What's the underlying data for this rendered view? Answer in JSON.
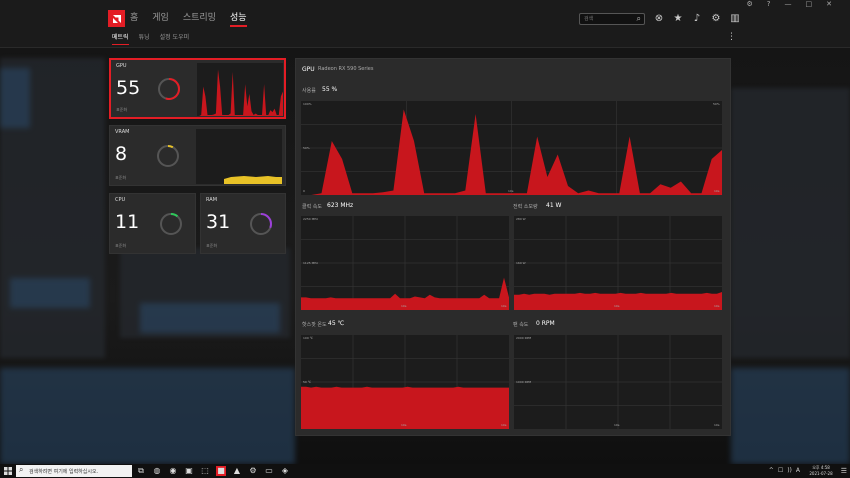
{
  "window": {
    "controls": [
      "⚙",
      "?",
      "—",
      "□",
      "✕"
    ]
  },
  "nav": {
    "tabs": [
      {
        "label": "홈",
        "active": false
      },
      {
        "label": "게임",
        "active": false
      },
      {
        "label": "스트리밍",
        "active": false
      },
      {
        "label": "성능",
        "active": true
      }
    ],
    "search_placeholder": "검색"
  },
  "subnav": {
    "tabs": [
      {
        "label": "메트릭",
        "active": true
      },
      {
        "label": "튜닝",
        "active": false
      },
      {
        "label": "설정 도우미",
        "active": false
      }
    ]
  },
  "tiles": {
    "gpu": {
      "label": "GPU",
      "value": "55",
      "sub": "표준화",
      "percent": 55,
      "color": "#e31d25"
    },
    "vram": {
      "label": "VRAM",
      "value": "8",
      "sub": "표준화",
      "percent": 8,
      "color": "#e8c227"
    },
    "cpu": {
      "label": "CPU",
      "value": "11",
      "sub": "표준화",
      "percent": 11,
      "color": "#2ec85a"
    },
    "ram": {
      "label": "RAM",
      "value": "31",
      "sub": "표준화",
      "percent": 31,
      "color": "#9c3fd9"
    }
  },
  "panel": {
    "title": "GPU",
    "device": "Radeon RX 590 Series",
    "usage": {
      "label": "사용률",
      "value": "55 %",
      "y_top": "100%",
      "y_mid": "50%",
      "y_zero": "0",
      "x_mid": "10s",
      "x_end": "10s",
      "y_top_right": "50%",
      "y_mid_right": "50%",
      "series": [
        0,
        0,
        2,
        60,
        40,
        2,
        2,
        2,
        3,
        5,
        95,
        60,
        2,
        2,
        2,
        2,
        5,
        90,
        2,
        2,
        2,
        2,
        2,
        65,
        20,
        45,
        10,
        2,
        5,
        2,
        2,
        2,
        65,
        2,
        2,
        12,
        8,
        15,
        2,
        2,
        40,
        50
      ]
    },
    "clock": {
      "label": "클럭 속도",
      "value": "623 MHz",
      "y_top": "2250 MHz",
      "y_mid": "1125 MHz",
      "x_mid": "10s",
      "x_end": "10s",
      "series": [
        14,
        14,
        13,
        13,
        13,
        13,
        14,
        13,
        13,
        13,
        13,
        13,
        13,
        13,
        13,
        13,
        13,
        13,
        13,
        18,
        13,
        13,
        13,
        15,
        14,
        13,
        17,
        14,
        13,
        13,
        13,
        13,
        13,
        13,
        13,
        13,
        13,
        17,
        13,
        13,
        13,
        36,
        14
      ]
    },
    "power": {
      "label": "전력 소모량",
      "value": "41 W",
      "y_top": "280 W",
      "y_mid": "160 W",
      "x_mid": "10s",
      "x_end": "10s",
      "series": [
        17,
        17,
        18,
        17,
        18,
        18,
        18,
        17,
        18,
        18,
        18,
        18,
        18,
        19,
        18,
        18,
        19,
        18,
        18,
        18,
        18,
        19,
        18,
        18,
        18,
        19,
        18,
        18,
        18,
        18,
        18,
        19,
        18,
        18,
        18,
        18,
        18,
        18,
        19,
        18,
        18,
        20
      ]
    },
    "temp": {
      "label": "핫스팟 온도",
      "value": "45 ℃",
      "y_top": "100 ℃",
      "y_mid": "50 ℃",
      "x_mid": "10s",
      "x_end": "10s",
      "series": [
        47,
        47,
        46,
        47,
        46,
        46,
        46,
        47,
        46,
        46,
        46,
        46,
        46,
        47,
        46,
        46,
        46,
        46,
        46,
        46,
        46,
        47,
        46,
        46,
        46,
        46,
        46,
        46,
        46,
        46,
        46,
        47,
        46,
        46,
        46,
        46,
        46,
        46,
        46,
        46,
        46,
        46
      ]
    },
    "fan": {
      "label": "팬 속도",
      "value": "0 RPM",
      "y_top": "2000 RPM",
      "y_mid": "1000 RPM",
      "x_mid": "10s",
      "x_end": "10s",
      "series": [
        0,
        0,
        0,
        0,
        0,
        0,
        0,
        0,
        0,
        0,
        0,
        0,
        0,
        0,
        0,
        0,
        0,
        0,
        0,
        0
      ]
    }
  },
  "taskbar": {
    "search_placeholder": "검색하려면 여기에 입력하십시오.",
    "apps": [
      "⧉",
      "◍",
      "◉",
      "▣",
      "⬚",
      "■",
      "▲",
      "⚙",
      "▭",
      "◈"
    ],
    "tray": [
      "^",
      "☐",
      "))",
      "A"
    ],
    "time": "오후 4:58",
    "date": "2021-07-28",
    "notif": "☰"
  },
  "colors": {
    "accent": "#e31d25",
    "chart_fill": "#c8161d",
    "grid": "#3a3a3a"
  }
}
